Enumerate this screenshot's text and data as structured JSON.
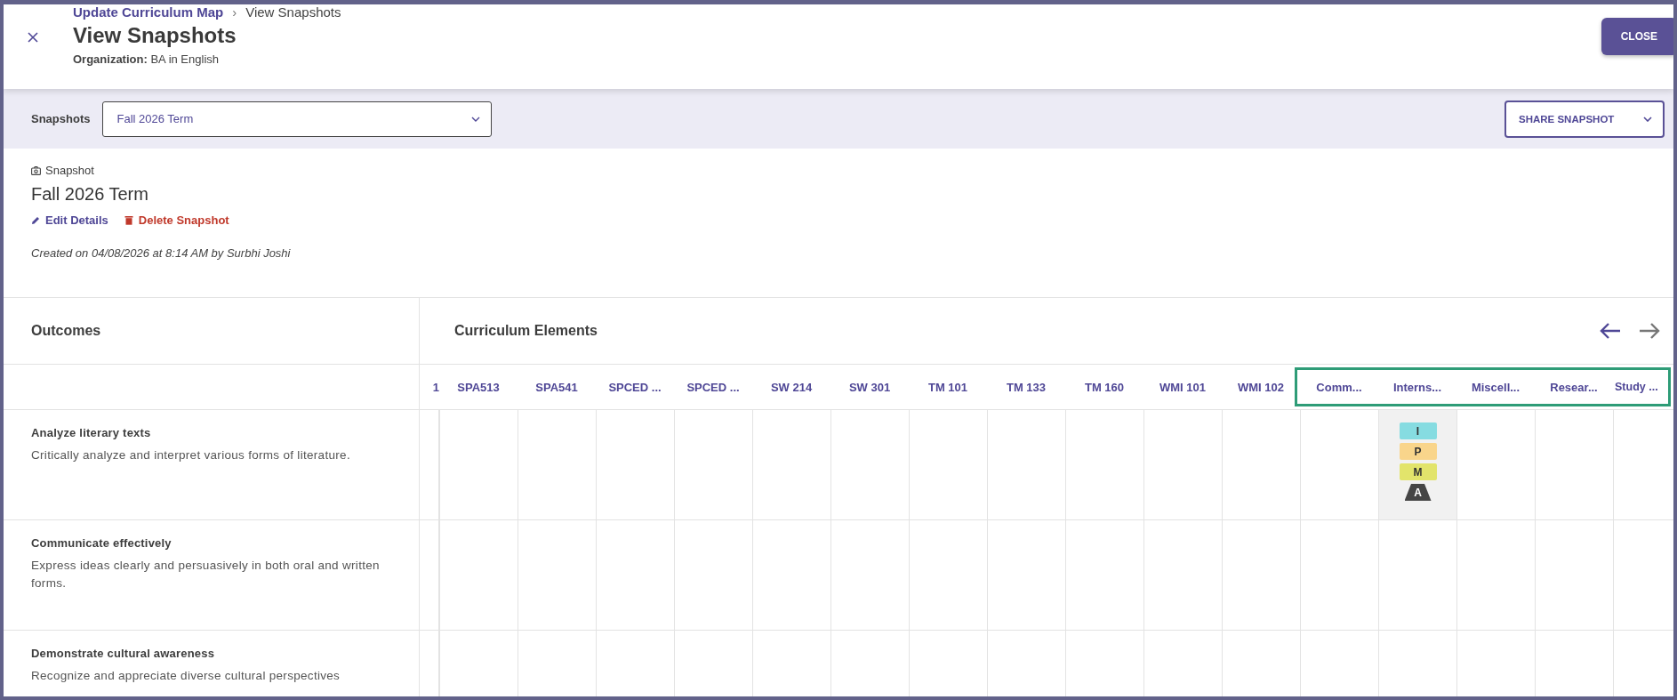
{
  "header": {
    "breadcrumb": [
      {
        "label": "Update Curriculum Map",
        "kind": "link"
      },
      {
        "label": "View Snapshots",
        "kind": "current"
      }
    ],
    "breadcrumb_separator": "›",
    "title": "View Snapshots",
    "organization": "**Organization:** BA in English",
    "close_button": "CLOSE"
  },
  "snapshot_bar": {
    "label": "Snapshots",
    "select_value": "Fall 2026 Term",
    "share_button": "SHARE SNAPSHOT"
  },
  "snapshot": {
    "caption": "Snapshot",
    "title": "Fall 2026 Term",
    "actions": [
      {
        "label": "Edit Details",
        "kind": "edit"
      },
      {
        "label": "Delete Snapshot",
        "kind": "delete"
      }
    ],
    "created": "Created on 04/08/2026 at 8:14 AM by Surbhi Joshi"
  },
  "map": {
    "outcomes_heading": "Outcomes",
    "elements_heading": "Curriculum Elements",
    "nav": [
      {
        "kind": "prev",
        "disabled": false
      },
      {
        "kind": "next",
        "disabled": true
      }
    ],
    "columns": [
      {
        "label": "1",
        "highlighted": false
      },
      {
        "label": "SPA513",
        "highlighted": false
      },
      {
        "label": "SPA541",
        "highlighted": false
      },
      {
        "label": "SPCED ...",
        "highlighted": false
      },
      {
        "label": "SPCED ...",
        "highlighted": false
      },
      {
        "label": "SW 214",
        "highlighted": false
      },
      {
        "label": "SW 301",
        "highlighted": false
      },
      {
        "label": "TM 101",
        "highlighted": false
      },
      {
        "label": "TM 133",
        "highlighted": false
      },
      {
        "label": "TM 160",
        "highlighted": false
      },
      {
        "label": "WMI 101",
        "highlighted": false
      },
      {
        "label": "WMI 102",
        "highlighted": false
      },
      {
        "label": "Comm...",
        "highlighted": true
      },
      {
        "label": "Interns...",
        "highlighted": true
      },
      {
        "label": "Miscell...",
        "highlighted": true
      },
      {
        "label": "Resear...",
        "highlighted": true
      },
      {
        "label": "Study ...",
        "highlighted": true
      }
    ],
    "rows": [
      {
        "title": "Analyze literary texts",
        "description": "Critically analyze and interpret various forms of literature.",
        "cells": [
          {
            "shaded": false
          },
          {
            "shaded": false
          },
          {
            "shaded": false
          },
          {
            "shaded": false
          },
          {
            "shaded": false
          },
          {
            "shaded": false
          },
          {
            "shaded": false
          },
          {
            "shaded": false
          },
          {
            "shaded": false
          },
          {
            "shaded": false
          },
          {
            "shaded": false
          },
          {
            "shaded": false
          },
          {
            "shaded": false
          },
          {
            "shaded": true,
            "badges": [
              {
                "label": "I",
                "kind": "tag",
                "color": "#86dce1"
              },
              {
                "label": "P",
                "kind": "tag",
                "color": "#f9d58b"
              },
              {
                "label": "M",
                "kind": "tag",
                "color": "#e2e46b"
              },
              {
                "label": "A",
                "kind": "assessment",
                "color": "#454545"
              }
            ]
          },
          {
            "shaded": false
          },
          {
            "shaded": false
          },
          {
            "shaded": false
          }
        ]
      },
      {
        "title": "Communicate effectively",
        "description": "Express ideas clearly and persuasively in both oral and written forms.",
        "cells": [
          {
            "shaded": false
          },
          {
            "shaded": false
          },
          {
            "shaded": false
          },
          {
            "shaded": false
          },
          {
            "shaded": false
          },
          {
            "shaded": false
          },
          {
            "shaded": false
          },
          {
            "shaded": false
          },
          {
            "shaded": false
          },
          {
            "shaded": false
          },
          {
            "shaded": false
          },
          {
            "shaded": false
          },
          {
            "shaded": false
          },
          {
            "shaded": false
          },
          {
            "shaded": false
          },
          {
            "shaded": false
          },
          {
            "shaded": false
          }
        ]
      },
      {
        "title": "Demonstrate cultural awareness",
        "description": "Recognize and appreciate diverse cultural perspectives",
        "cells": [
          {
            "shaded": false
          },
          {
            "shaded": false
          },
          {
            "shaded": false
          },
          {
            "shaded": false
          },
          {
            "shaded": false
          },
          {
            "shaded": false
          },
          {
            "shaded": false
          },
          {
            "shaded": false
          },
          {
            "shaded": false
          },
          {
            "shaded": false
          },
          {
            "shaded": false
          },
          {
            "shaded": false
          },
          {
            "shaded": false
          },
          {
            "shaded": false
          },
          {
            "shaded": false
          },
          {
            "shaded": false
          },
          {
            "shaded": false
          }
        ]
      }
    ]
  }
}
